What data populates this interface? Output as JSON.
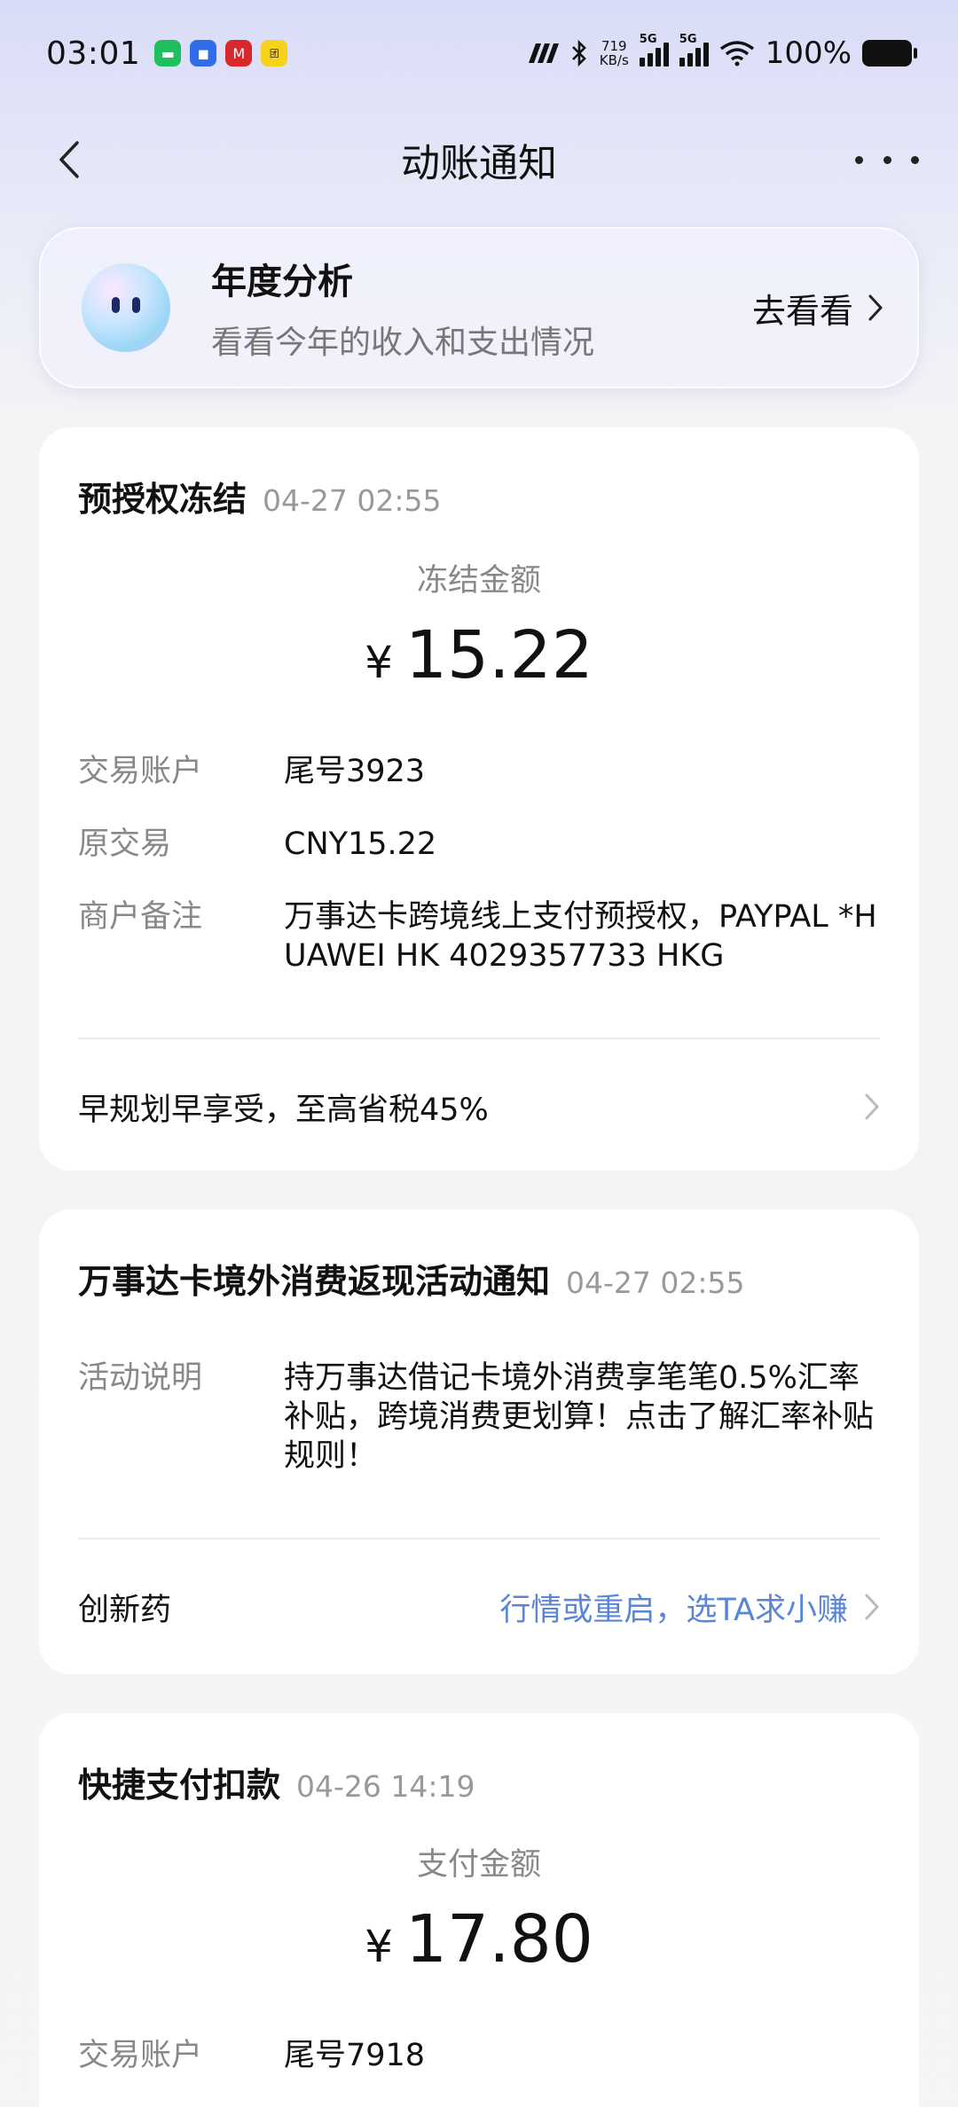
{
  "status_bar": {
    "time": "03:01",
    "net_speed_value": "719",
    "net_speed_unit": "KB/s",
    "signal1_label": "5G",
    "signal2_label": "5G",
    "battery": "100%",
    "app_icons": [
      "chat-app-icon",
      "message-app-icon",
      "bank-app-icon",
      "shopping-app-icon"
    ]
  },
  "nav": {
    "title": "动账通知"
  },
  "banner": {
    "title": "年度分析",
    "subtitle": "看看今年的收入和支出情况",
    "link": "去看看"
  },
  "cards": [
    {
      "title": "预授权冻结",
      "time": "04-27 02:55",
      "amount_label": "冻结金额",
      "currency": "¥",
      "amount": "15.22",
      "rows": [
        {
          "k": "交易账户",
          "v": "尾号3923"
        },
        {
          "k": "原交易",
          "v": "CNY15.22"
        },
        {
          "k": "商户备注",
          "v": "万事达卡跨境线上支付预授权，PAYPAL *HUAWEI HK 4029357733 HKG"
        }
      ],
      "footer": "早规划早享受，至高省税45%"
    },
    {
      "title": "万事达卡境外消费返现活动通知",
      "time": "04-27 02:55",
      "rows": [
        {
          "k": "活动说明",
          "v": "持万事达借记卡境外消费享笔笔0.5%汇率补贴，跨境消费更划算！点击了解汇率补贴规则！"
        }
      ],
      "footer": "创新药",
      "footer_promo": "行情或重启，选TA求小赚"
    },
    {
      "title": "快捷支付扣款",
      "time": "04-26 14:19",
      "amount_label": "支付金额",
      "currency": "¥",
      "amount": "17.80",
      "rows": [
        {
          "k": "交易账户",
          "v": "尾号7918"
        }
      ]
    }
  ]
}
